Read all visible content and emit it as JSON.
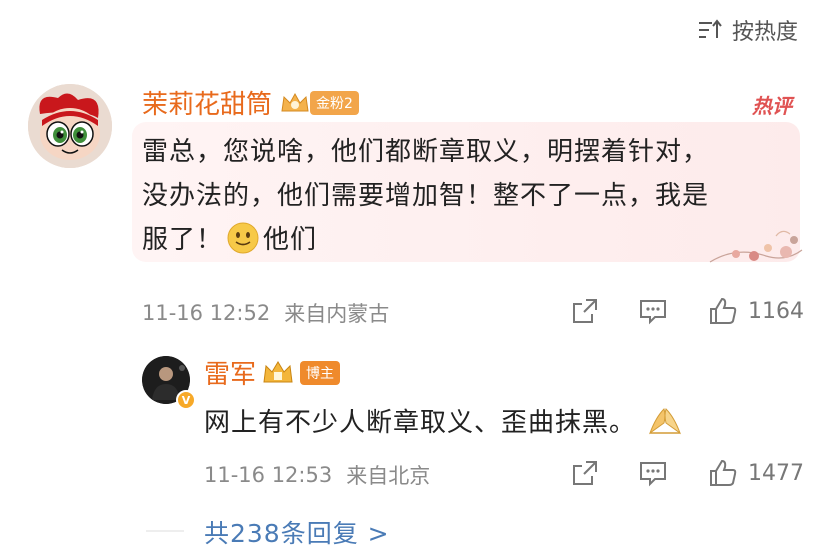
{
  "sort": {
    "label": "按热度",
    "icon": "sort-icon"
  },
  "comment": {
    "username": "茉莉花甜筒",
    "fan_badge": "金粉2",
    "hot_label": "热评",
    "text_line1": "雷总，您说啥，他们都断章取义，明摆着针对，",
    "text_line2": "没办法的，他们需要增加智！整不了一点，我是",
    "text_line3_a": "服了！",
    "text_line3_b": "他们",
    "emoji": "smile-emoji",
    "time": "11-16 12:52",
    "location": "来自内蒙古",
    "likes": "1164"
  },
  "reply": {
    "username": "雷军",
    "role_badge": "博主",
    "text": "网上有不少人断章取义、歪曲抹黑。",
    "emoji": "praying-hands-emoji",
    "time": "11-16 12:53",
    "location": "来自北京",
    "likes": "1477"
  },
  "more_replies": "共238条回复 >",
  "colors": {
    "username": "#e86a1c",
    "hot": "#e05353",
    "link": "#4a7bb6",
    "meta": "#8a8a8a",
    "bubble": "#fdeeee"
  }
}
